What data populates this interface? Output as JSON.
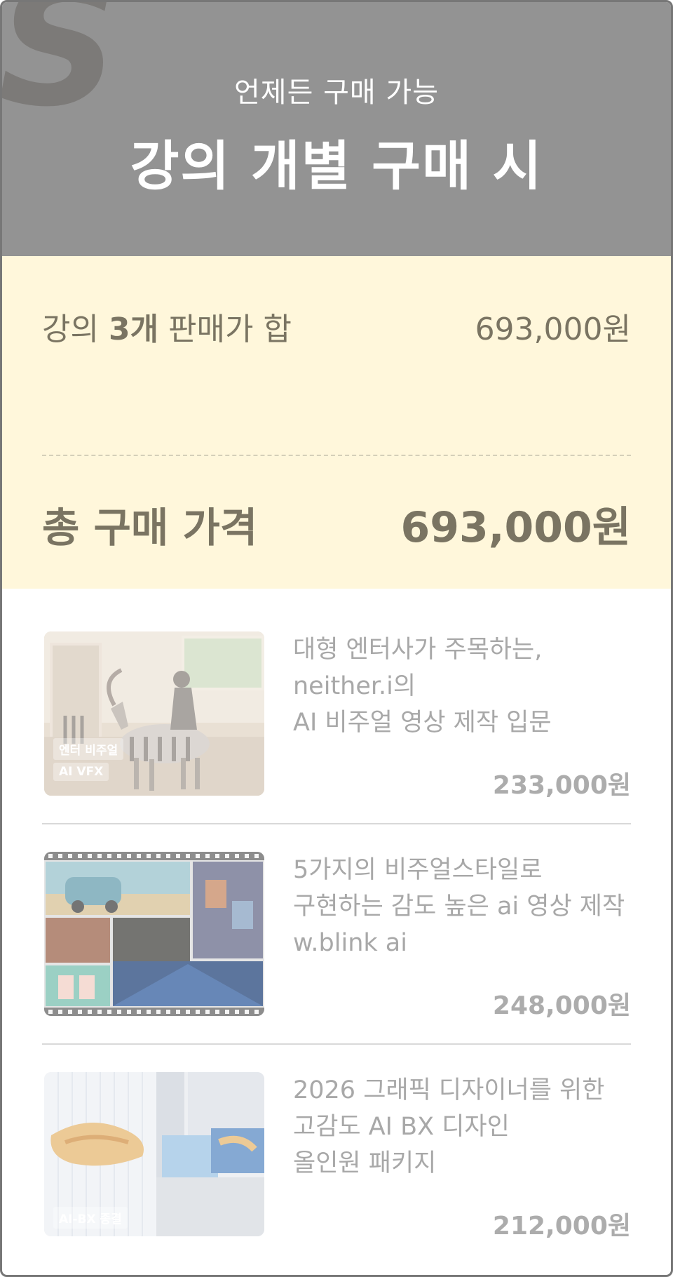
{
  "header": {
    "subtitle": "언제든 구매 가능",
    "title": "강의 개별 구매 시",
    "background_color": "#939393",
    "logo_icon": "s-logo-icon"
  },
  "summary": {
    "label_prefix": "강의 ",
    "label_count": "3개",
    "label_suffix": " 판매가 합",
    "sum_amount": "693,000원",
    "total_label": "총 구매 가격",
    "total_amount": "693,000원",
    "background_color": "#fff7db"
  },
  "courses": [
    {
      "title_lines": [
        "대형 엔터사가 주목하는,",
        "neither.i의",
        "AI 비주얼 영상 제작 입문"
      ],
      "price": "233,000원",
      "tags": [
        "엔터 비주얼",
        "AI VFX"
      ],
      "thumb_icon": "zebra-rider-thumbnail"
    },
    {
      "title_lines": [
        "5가지의 비주얼스타일로",
        "구현하는 감도 높은 ai 영상 제작",
        "w.blink ai"
      ],
      "price": "248,000원",
      "tags": [],
      "thumb_icon": "film-strip-collage-thumbnail"
    },
    {
      "title_lines": [
        "2026 그래픽 디자이너를 위한",
        "고감도 AI BX 디자인",
        "올인원 패키지"
      ],
      "price": "212,000원",
      "tags": [
        "AI-BX 종결"
      ],
      "thumb_icon": "city-billboard-thumbnail"
    }
  ]
}
